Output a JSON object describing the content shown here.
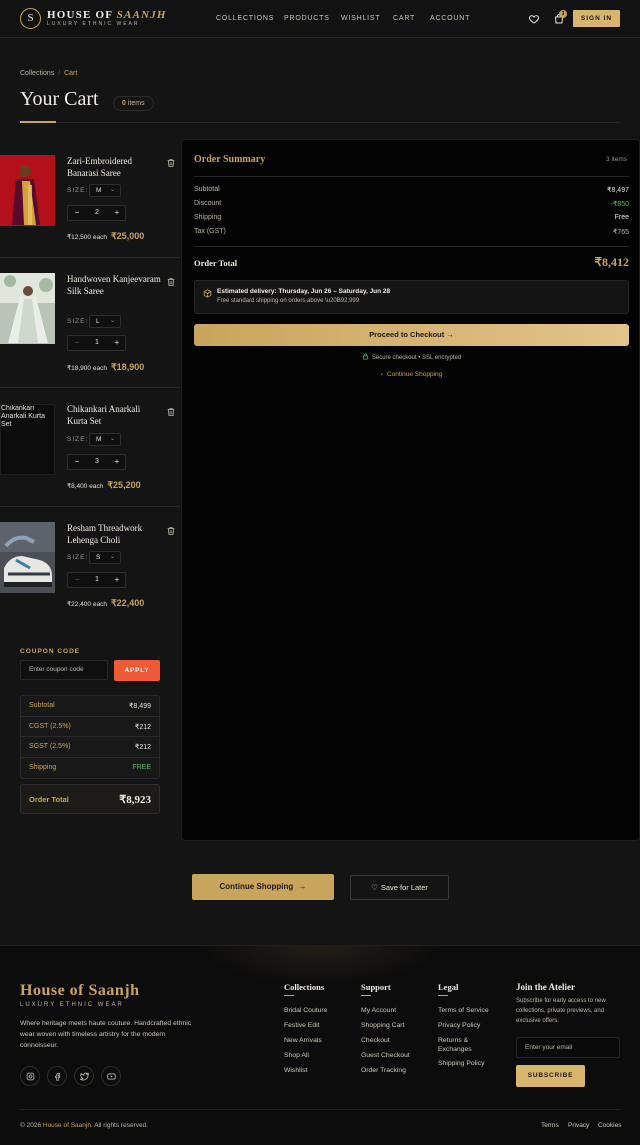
{
  "header": {
    "logo_letter": "S",
    "brand_main": "HOUSE OF ",
    "brand_accent": "SAANJH",
    "brand_sub": "LUXURY ETHNIC WEAR",
    "nav": [
      "COLLECTIONS",
      "PRODUCTS",
      "WISHLIST",
      "CART",
      "ACCOUNT"
    ],
    "cart_badge": "3",
    "signin_label": "SIGN IN"
  },
  "breadcrumb": {
    "root": "Collections",
    "sep": "/",
    "current": "Cart"
  },
  "page": {
    "title": "Your Cart",
    "count_num": "0",
    "count_label": "items"
  },
  "items": [
    {
      "name": "Zari-Embroidered Banarasi Saree",
      "size_label": "SIZE:",
      "size": "M",
      "qty": "2",
      "each_price": "₹12,500",
      "each_label": "each",
      "total": "₹25,000"
    },
    {
      "name": "Handwoven Kanjeevaram Silk Saree",
      "size_label": "SIZE:",
      "size": "L",
      "qty": "1",
      "each_price": "₹18,900",
      "each_label": "each",
      "total": "₹18,900"
    },
    {
      "name": "Chikankari Anarkali Kurta Set",
      "size_label": "SIZE:",
      "size": "M",
      "qty": "3",
      "each_price": "₹8,400",
      "each_label": "each",
      "total": "₹25,200",
      "image_alt": "Chikankari Anarkali Kurta Set"
    },
    {
      "name": "Resham Threadwork Lehenga Choli",
      "size_label": "SIZE:",
      "size": "S",
      "qty": "1",
      "each_price": "₹22,400",
      "each_label": "each",
      "total": "₹22,400"
    }
  ],
  "coupon": {
    "label": "COUPON CODE",
    "placeholder": "Enter coupon code",
    "apply": "APPLY"
  },
  "mini_summary": {
    "rows": [
      {
        "k": "Subtotal",
        "v": "₹8,499"
      },
      {
        "k": "CGST (2.5%)",
        "v": "₹212"
      },
      {
        "k": "SGST (2.5%)",
        "v": "₹212"
      },
      {
        "k": "Shipping",
        "v": "FREE"
      }
    ],
    "total_label": "Order Total",
    "total_value": "₹8,923"
  },
  "summary": {
    "title": "Order Summary",
    "count": "3 items",
    "rows": [
      {
        "k": "Subtotal",
        "v": "₹8,497"
      },
      {
        "k": "Discount",
        "v": "-₹850"
      },
      {
        "k": "Shipping",
        "v": "Free"
      },
      {
        "k": "Tax (GST)",
        "v": "₹765"
      }
    ],
    "total_label": "Order Total",
    "total_value": "₹8,412",
    "delivery_line1": "Estimated delivery: Thursday, Jun 26 – Saturday, Jun 28",
    "delivery_line2": "Free standard shipping on orders above \\u20B92,999",
    "checkout": "Proceed to Checkout",
    "secure": "Secure checkout • SSL encrypted",
    "continue": "Continue Shopping"
  },
  "actions": {
    "continue": "Continue Shopping",
    "save": "Save for Later"
  },
  "footer": {
    "brand": "House of Saanjh",
    "sub": "LUXURY ETHNIC WEAR",
    "desc": "Where heritage meets haute couture. Handcrafted ethnic wear woven with timeless artistry for the modern connoisseur.",
    "collections": {
      "title": "Collections",
      "links": [
        "Bridal Couture",
        "Festive Edit",
        "New Arrivals",
        "Shop All",
        "Wishlist"
      ]
    },
    "support": {
      "title": "Support",
      "links": [
        "My Account",
        "Shopping Cart",
        "Checkout",
        "Guest Checkout",
        "Order Tracking"
      ]
    },
    "legal": {
      "title": "Legal",
      "links": [
        "Terms of Service",
        "Privacy Policy",
        "Returns & Exchanges",
        "Shipping Policy"
      ]
    },
    "join": {
      "title": "Join the Atelier",
      "desc": "Subscribe for early access to new collections, private previews, and exclusive offers.",
      "placeholder": "Enter your email",
      "button": "SUBSCRIBE"
    },
    "copyright_pre": "© 2026 ",
    "copyright_brand": "House of Saanjh",
    "copyright_post": ". All rights reserved.",
    "bottom_links": [
      "Terms",
      "Privacy",
      "Cookies"
    ]
  },
  "colors": {
    "accent": "#c9a45c",
    "background": "#141414",
    "apply": "#ee5a36",
    "success": "#5fb86a"
  }
}
